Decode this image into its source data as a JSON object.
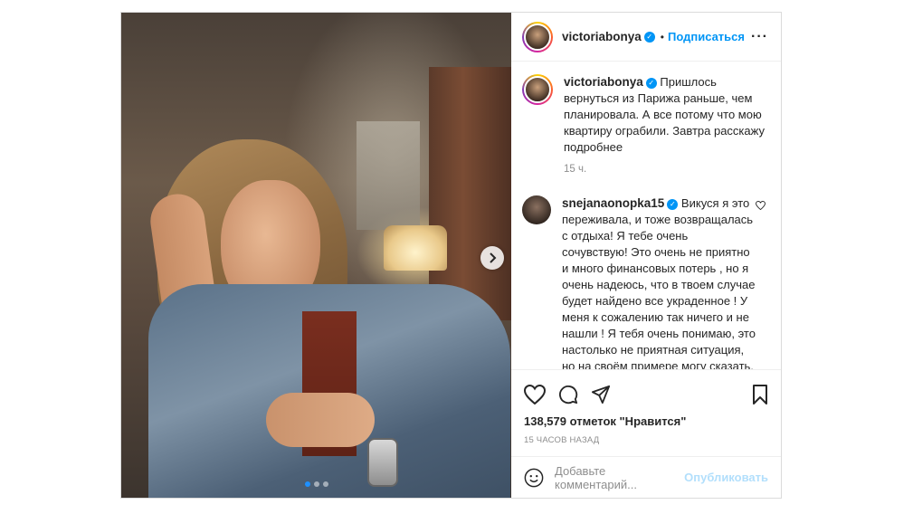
{
  "post": {
    "author": "victoriabonya",
    "follow_label": "Подписаться",
    "caption": "Пришлось вернуться из Парижа раньше, чем планировала. А все потому что мою квартиру ограбили. Завтра расскажу подробнее",
    "caption_time": "15 ч.",
    "carousel": {
      "total": 3,
      "active": 1
    }
  },
  "comments": [
    {
      "user": "snejanaonopka15",
      "text": "Викуся я это переживала, и тоже возвращалась с отдыха! Я тебе очень сочувствую! Это очень не приятно и много финансовых потерь , но я очень надеюсь, что в твоем случае будет найдено все украденное ! У меня к сожалению так ничего и не нашли ! Я тебя очень понимаю, это настолько не приятная ситуация, но на своём примере могу сказать, на чужом"
    }
  ],
  "footer": {
    "likes": "138,579 отметок \"Нравится\"",
    "posted_ago": "15 ЧАСОВ НАЗАД",
    "comment_placeholder": "Добавьте комментарий...",
    "publish_label": "Опубликовать"
  },
  "icons": {
    "more": "more-icon",
    "verified": "verified-badge-icon",
    "like": "heart-icon",
    "comment": "comment-icon",
    "share": "share-icon",
    "save": "bookmark-icon",
    "emoji": "emoji-icon",
    "next": "chevron-right-icon"
  },
  "colors": {
    "accent": "#0095f6",
    "text": "#262626",
    "muted": "#8e8e8e",
    "publish_disabled": "#b2dffc"
  }
}
